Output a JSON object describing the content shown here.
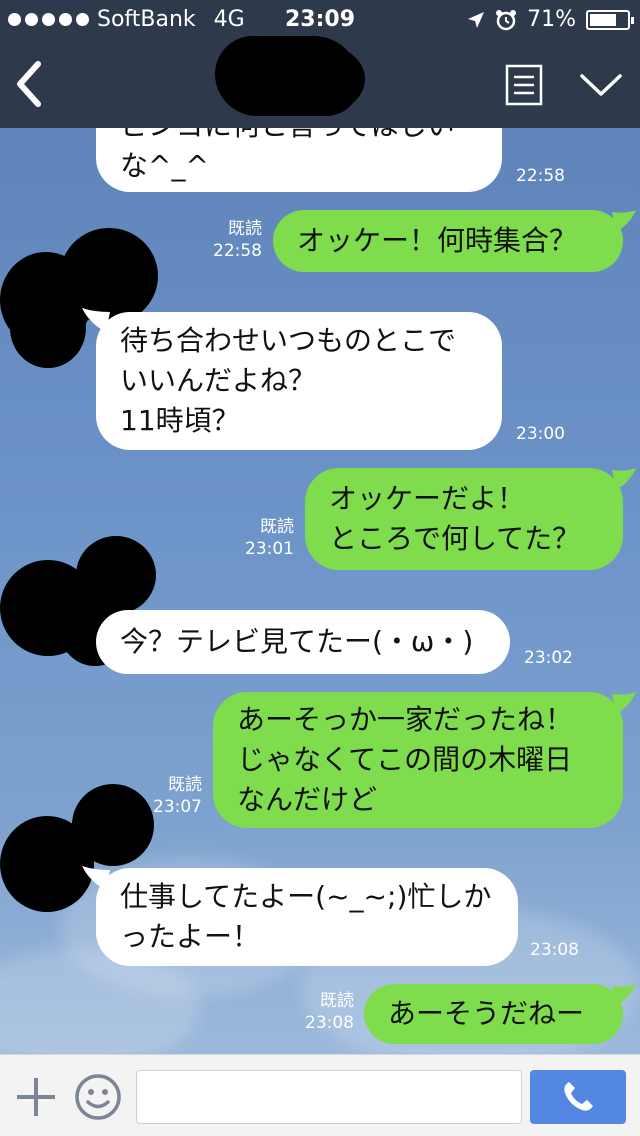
{
  "status_bar": {
    "carrier": "SoftBank",
    "network": "4G",
    "time": "23:09",
    "battery_percent": "71%",
    "battery_level": 0.71
  },
  "nav": {
    "back_icon": "chevron-left-icon",
    "menu_icon": "list-menu-icon",
    "more_icon": "chevron-down-icon"
  },
  "messages": [
    {
      "side": "in",
      "lines": [
        "ビンゴに何と言ってほしい",
        "な^_^"
      ],
      "time": "22:58",
      "read": ""
    },
    {
      "side": "out",
      "lines": [
        "オッケー！何時集合？"
      ],
      "time": "22:58",
      "read": "既読"
    },
    {
      "side": "in",
      "lines": [
        "待ち合わせいつものとこで",
        "いいんだよね？",
        "11時頃？"
      ],
      "time": "23:00",
      "read": ""
    },
    {
      "side": "out",
      "lines": [
        "オッケーだよ！",
        "ところで何してた？"
      ],
      "time": "23:01",
      "read": "既読"
    },
    {
      "side": "in",
      "lines": [
        "今？テレビ見てたー(・ω・)"
      ],
      "time": "23:02",
      "read": ""
    },
    {
      "side": "out",
      "lines": [
        "あーそっか一家だったね！",
        "じゃなくてこの間の木曜日",
        "なんだけど"
      ],
      "time": "23:07",
      "read": "既読"
    },
    {
      "side": "in",
      "lines": [
        "仕事してたよー(~_~;)忙しか",
        "ったよー！"
      ],
      "time": "23:08",
      "read": ""
    },
    {
      "side": "out",
      "lines": [
        "あーそうだねー"
      ],
      "time": "23:08",
      "read": "既読"
    }
  ],
  "input_bar": {
    "plus_icon": "plus-icon",
    "sticker_icon": "smiley-icon",
    "message_placeholder": "",
    "call_icon": "phone-icon"
  },
  "colors": {
    "header": "#2e3a4b",
    "incoming_bubble": "#ffffff",
    "outgoing_bubble": "#7fdc4c",
    "call_button": "#5487e2"
  }
}
